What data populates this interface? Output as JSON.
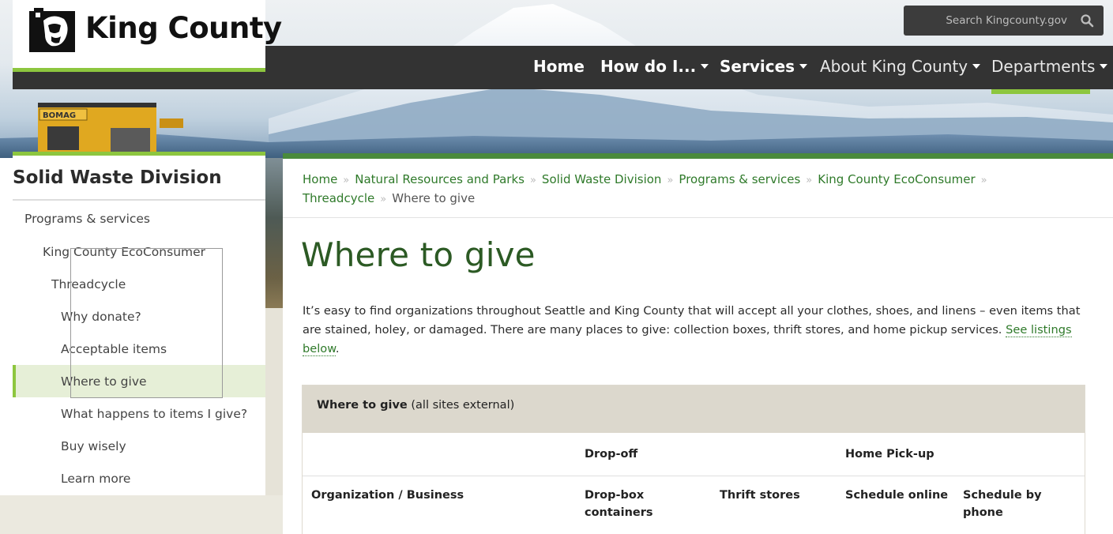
{
  "header": {
    "logo_text": "King County",
    "search_placeholder": "Search Kingcounty.gov",
    "nav": [
      {
        "label": "Home",
        "has_dropdown": false
      },
      {
        "label": "How do I...",
        "has_dropdown": true
      },
      {
        "label": "Services",
        "has_dropdown": true
      },
      {
        "label": "About King County",
        "has_dropdown": true
      },
      {
        "label": "Departments",
        "has_dropdown": true
      }
    ],
    "vehicle_label": "BOMAG"
  },
  "sidebar": {
    "title": "Solid Waste Division",
    "items": [
      {
        "label": "Programs & services",
        "level": 0
      },
      {
        "label": "King County EcoConsumer",
        "level": 1
      },
      {
        "label": "Threadcycle",
        "level": 2
      },
      {
        "label": "Why donate?",
        "level": 3
      },
      {
        "label": "Acceptable items",
        "level": 3
      },
      {
        "label": "Where to give",
        "level": 3,
        "active": true
      },
      {
        "label": "What happens to items I give?",
        "level": 3
      },
      {
        "label": "Buy wisely",
        "level": 3
      },
      {
        "label": "Learn more",
        "level": 3
      }
    ]
  },
  "breadcrumb": {
    "items": [
      "Home",
      "Natural Resources and Parks",
      "Solid Waste Division",
      "Programs & services",
      "King County EcoConsumer",
      "Threadcycle"
    ],
    "current": "Where to give"
  },
  "main": {
    "title": "Where to give",
    "intro": "It’s easy to find organizations throughout Seattle and King County that will accept all your clothes, shoes, and linens – even items that are stained, holey, or damaged. There are many places to give: collection boxes, thrift stores, and home pickup services.",
    "intro_link": "See listings below",
    "intro_end": "."
  },
  "table": {
    "caption_bold": "Where to give",
    "caption_rest": " (all sites external)",
    "group_headers": [
      "Drop-off",
      "Home Pick-up"
    ],
    "columns": [
      "Organization / Business",
      "Drop-box containers",
      "Thrift stores",
      "Schedule online",
      "Schedule by phone"
    ]
  },
  "colors": {
    "accent_green": "#8dc63f",
    "link_green": "#2f7a2a",
    "title_green": "#2c5a24",
    "nav_bg": "#333333",
    "caption_bg": "#dcd8cd"
  },
  "icons": [
    "king-county-logo-icon",
    "search-icon",
    "chevron-down-icon"
  ]
}
